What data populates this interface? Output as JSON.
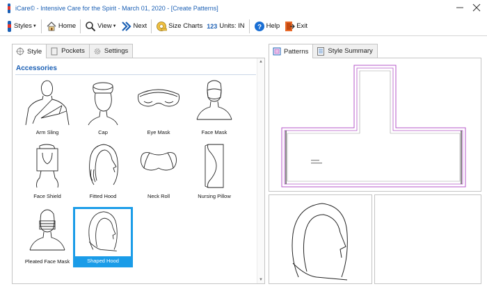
{
  "window": {
    "title": "iCare© - Intensive Care for the Spirit - March 01, 2020 - [Create Patterns]"
  },
  "toolbar": {
    "styles_label": "Styles",
    "home_label": "Home",
    "view_label": "View",
    "next_label": "Next",
    "size_charts_label": "Size Charts",
    "units_number_glyph": "123",
    "units_label": "Units: IN",
    "help_label": "Help",
    "exit_label": "Exit"
  },
  "left_tabs": [
    {
      "label": "Style",
      "icon": "style-icon",
      "active": true
    },
    {
      "label": "Pockets",
      "icon": "pocket-icon",
      "active": false
    },
    {
      "label": "Settings",
      "icon": "gear-icon",
      "active": false
    }
  ],
  "right_tabs": [
    {
      "label": "Patterns",
      "icon": "patterns-icon",
      "active": true
    },
    {
      "label": "Style Summary",
      "icon": "summary-icon",
      "active": false
    }
  ],
  "section": {
    "title": "Accessories"
  },
  "items": [
    {
      "label": "Arm Sling",
      "icon": "arm-sling-icon"
    },
    {
      "label": "Cap",
      "icon": "cap-icon"
    },
    {
      "label": "Eye Mask",
      "icon": "eye-mask-icon"
    },
    {
      "label": "Face Mask",
      "icon": "face-mask-icon"
    },
    {
      "label": "Face Shield",
      "icon": "face-shield-icon"
    },
    {
      "label": "Fitted Hood",
      "icon": "fitted-hood-icon"
    },
    {
      "label": "Neck Roll",
      "icon": "neck-roll-icon"
    },
    {
      "label": "Nursing Pillow",
      "icon": "nursing-pillow-icon"
    },
    {
      "label": "Pleated Face Mask",
      "icon": "pleated-face-mask-icon"
    },
    {
      "label": "Shaped Hood",
      "icon": "shaped-hood-icon",
      "selected": true
    }
  ],
  "colors": {
    "accent": "#1a9ce8",
    "title_text": "#1a5fb4",
    "pattern_outline": "#b455c8"
  }
}
